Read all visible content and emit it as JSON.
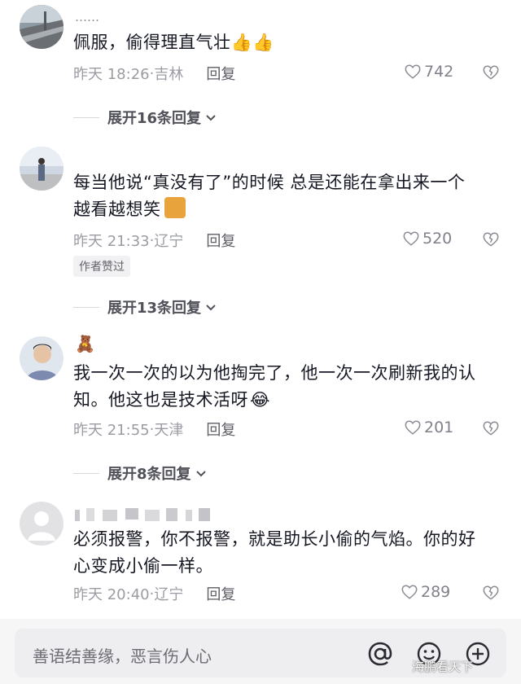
{
  "comments": [
    {
      "username": "……",
      "text": "佩服，偷得理直气壮",
      "emoji": "👍👍",
      "time": "昨天 18:26",
      "location": "吉林",
      "reply": "回复",
      "likes": "742",
      "expand": "展开16条回复"
    },
    {
      "username": "",
      "text_line1": "每当他说“真没有了”的时候   总是还能在拿出来一个",
      "text_line2": "越看越想笑",
      "time": "昨天 21:33",
      "location": "辽宁",
      "reply": "回复",
      "likes": "520",
      "badge": "作者赞过",
      "expand": "展开13条回复"
    },
    {
      "username": "🧸",
      "text_line1": "我一次一次的以为他掏完了，他一次一次刷新我的认",
      "text_line2": "知。他这也是技术活呀",
      "time": "昨天 21:55",
      "location": "天津",
      "reply": "回复",
      "likes": "201",
      "expand": "展开8条回复"
    },
    {
      "username": "",
      "text_line1": "必须报警，你不报警，就是助长小偷的气焰。你的好",
      "text_line2": "心变成小偷一样。",
      "time": "昨天 20:40",
      "location": "辽宁",
      "reply": "回复",
      "likes": "289"
    }
  ],
  "bottom_bar": {
    "placeholder": "善语结善缘，恶言伤人心",
    "mention_icon": "at-icon",
    "emoji_icon": "smiley-icon",
    "add_icon": "plus-circle-icon"
  },
  "watermark": "海鹏看天下",
  "colors": {
    "text": "#161823",
    "meta": "#9b9ca3",
    "background": "#ffffff"
  }
}
